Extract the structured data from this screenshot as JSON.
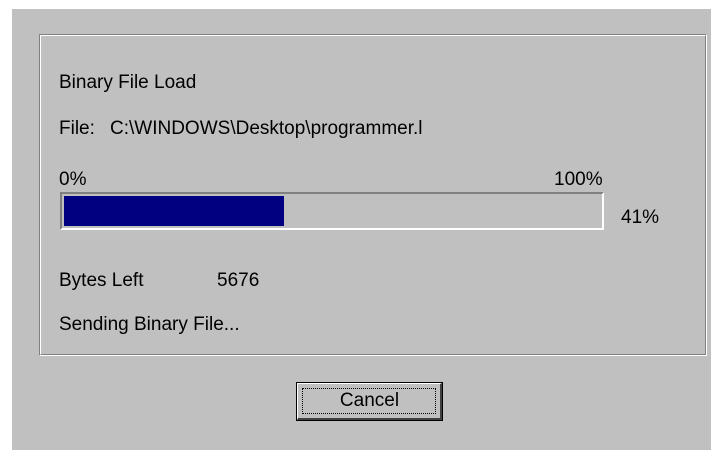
{
  "dialog": {
    "title": "Binary File Load",
    "file_label": "File:",
    "file_path": "C:\\WINDOWS\\Desktop\\programmer.l",
    "progress": {
      "min_label": "0%",
      "max_label": "100%",
      "percent_label": "41%",
      "fraction": 0.41,
      "fill_color": "#000080"
    },
    "bytes_left_label": "Bytes Left",
    "bytes_left_value": "5676",
    "status_text": "Sending Binary File...",
    "cancel_label": "Cancel"
  },
  "colors": {
    "face": "#c0c0c0",
    "highlight": "#ffffff",
    "shadow": "#808080"
  }
}
